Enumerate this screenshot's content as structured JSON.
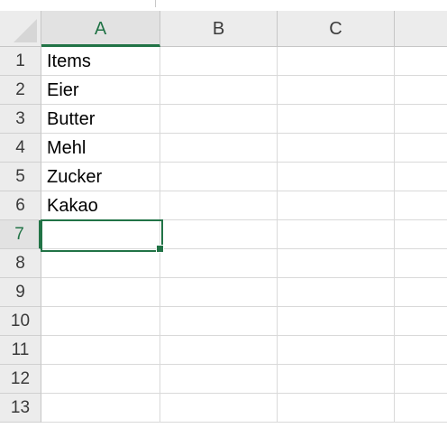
{
  "columns": [
    "A",
    "B",
    "C"
  ],
  "rows": [
    "1",
    "2",
    "3",
    "4",
    "5",
    "6",
    "7",
    "8",
    "9",
    "10",
    "11",
    "12",
    "13"
  ],
  "cells": {
    "A": [
      "Items",
      "Eier",
      "Butter",
      "Mehl",
      "Zucker",
      "Kakao",
      "",
      "",
      "",
      "",
      "",
      "",
      ""
    ]
  },
  "selection": {
    "active_cell": "A7",
    "accent_color": "#217346"
  },
  "colors": {
    "header_bg": "#ececec",
    "gridline": "#d9d9d9",
    "accent": "#217346"
  }
}
